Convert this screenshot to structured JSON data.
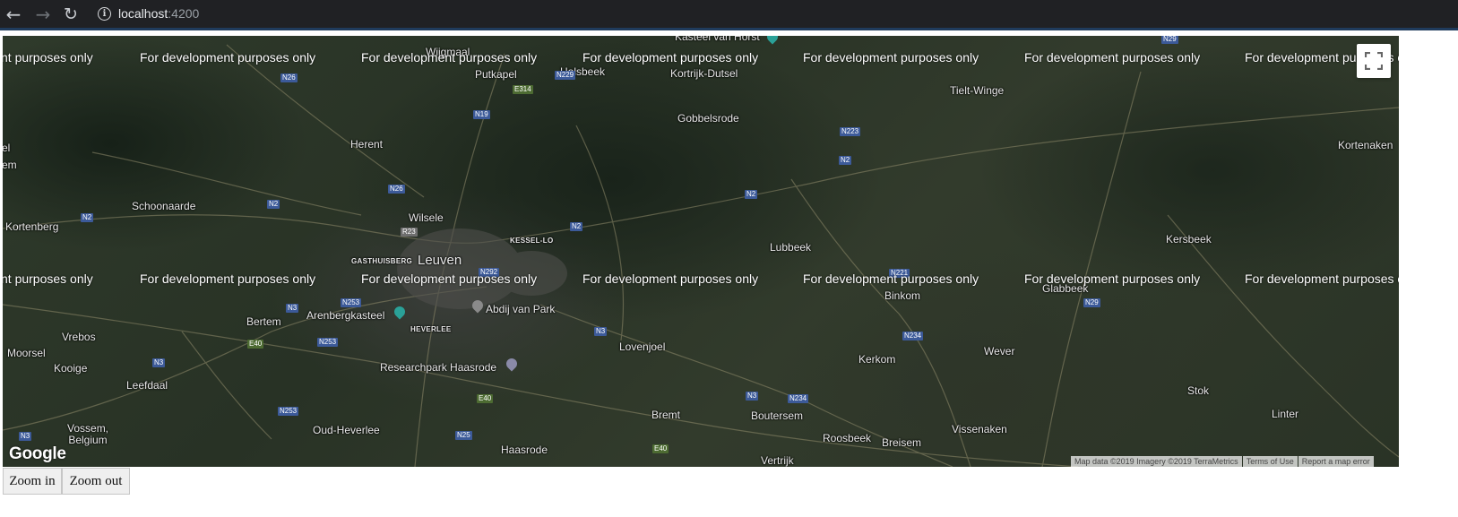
{
  "browser": {
    "back_icon": "arrow-left-icon",
    "forward_icon": "arrow-right-icon",
    "reload_icon": "reload-icon",
    "info_icon": "info-icon",
    "url_host": "localhost",
    "url_port": ":4200"
  },
  "map": {
    "watermark": "For development purposes only",
    "watermark_partial_left": "nt purposes only",
    "watermark_partial_right": "For development purposes o",
    "places": {
      "wijgmaal": "Wijgmaal",
      "putkapel": "Putkapel",
      "holsbeek": "Holsbeek",
      "kortrijk_dutsel": "Kortrijk-Dutsel",
      "kasteel_van_horst": "Kasteel van Horst",
      "tielt_winge": "Tielt-Winge",
      "gobbelsrode": "Gobbelsrode",
      "herent": "Herent",
      "kortenaken": "Kortenaken",
      "schoonaarde": "Schoonaarde",
      "kortenberg": "Kortenberg",
      "wilsele": "Wilsele",
      "kessel_lo": "KESSEL-LO",
      "leuven": "Leuven",
      "gasthuisberg": "GASTHUISBERG",
      "lubbeek": "Lubbeek",
      "kersbeek": "Kersbeek",
      "binkom": "Binkom",
      "glabbeek": "Glabbeek",
      "bertem": "Bertem",
      "arenbergkasteel": "Arenbergkasteel",
      "abdij_van_park": "Abdij van Park",
      "heverlee": "HEVERLEE",
      "vrebos": "Vrebos",
      "moorsel": "Moorsel",
      "lovenjoel": "Lovenjoel",
      "wever": "Wever",
      "kooige": "Kooige",
      "kerkom": "Kerkom",
      "researchpark": "Researchpark Haasrode",
      "leefdaal": "Leefdaal",
      "stok": "Stok",
      "bremt": "Bremt",
      "boutersem": "Boutersem",
      "linter": "Linter",
      "vossem_belgium": "Vossem,\nBelgium",
      "oud_heverlee": "Oud-Heverlee",
      "vissenaken": "Vissenaken",
      "haasrode": "Haasrode",
      "roosbeek": "Roosbeek",
      "breisem": "Breisem",
      "vertrijk": "Vertrijk",
      "el": "el",
      "em": "em"
    },
    "roads": {
      "n26a": "N26",
      "n229": "N229",
      "e314": "E314",
      "n19": "N19",
      "n29a": "N29",
      "n223": "N223",
      "n2a": "N2",
      "n26b": "N26",
      "n2b": "N2",
      "n2c": "N2",
      "n2d": "N2",
      "n2e": "N2",
      "r23": "R23",
      "n292": "N292",
      "n253a": "N253",
      "n3a": "N3",
      "e40a": "E40",
      "n253b": "N253",
      "n3b": "N3",
      "n3c": "N3",
      "n234a": "N234",
      "n29b": "N29",
      "e40b": "E40",
      "n253c": "N253",
      "n3d": "N3",
      "n234b": "N234",
      "n25": "N25",
      "e40c": "E40",
      "n3e": "N3",
      "n221": "N221"
    },
    "google_logo": "Google",
    "attribution": {
      "map_data": "Map data ©2019 Imagery ©2019 TerraMetrics",
      "terms": "Terms of Use",
      "report": "Report a map error"
    },
    "fullscreen_icon": "fullscreen-icon"
  },
  "controls": {
    "zoom_in": "Zoom in",
    "zoom_out": "Zoom out"
  }
}
